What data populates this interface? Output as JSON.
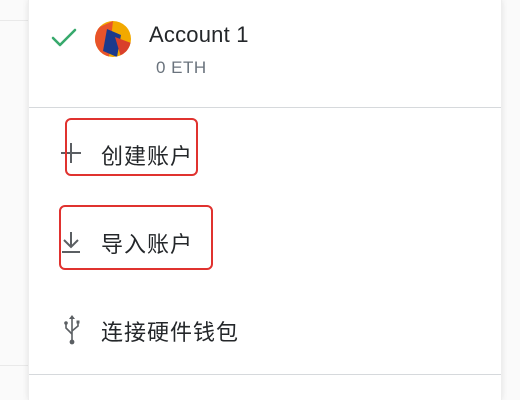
{
  "colors": {
    "check": "#37a96c",
    "text_primary": "#24272a",
    "text_secondary": "#6a737d",
    "highlight": "#e0322f",
    "divider": "#d6d9dc"
  },
  "account": {
    "selected": true,
    "name": "Account 1",
    "balance": "0 ETH",
    "avatar_icon": "jazzicon-avatar",
    "check_icon": "check-icon"
  },
  "menu": {
    "items": [
      {
        "label": "创建账户",
        "icon": "plus-icon",
        "highlighted": true
      },
      {
        "label": "导入账户",
        "icon": "download-icon",
        "highlighted": true
      },
      {
        "label": "连接硬件钱包",
        "icon": "usb-icon",
        "highlighted": false
      }
    ]
  }
}
